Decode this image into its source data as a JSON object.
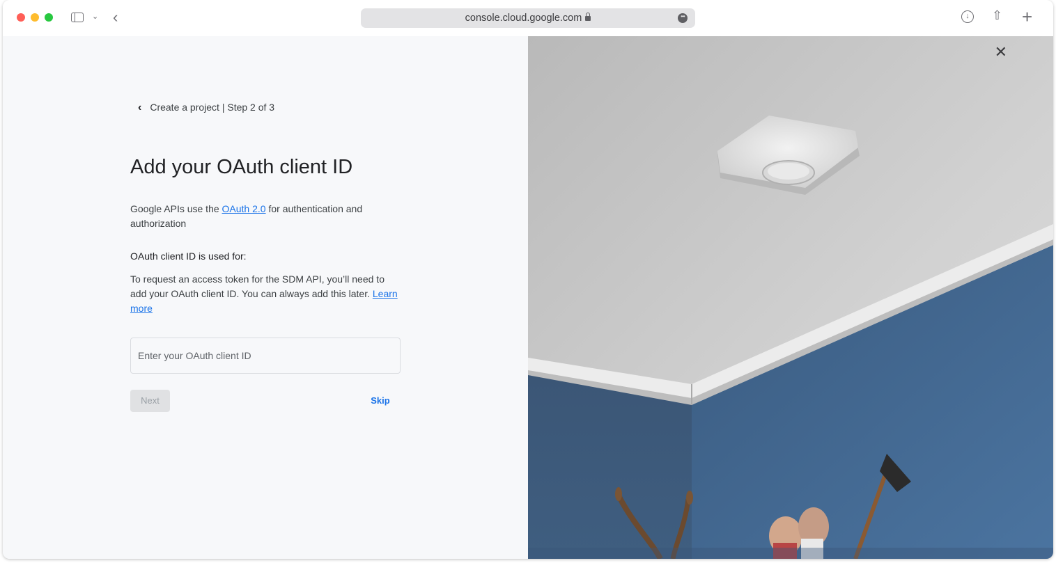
{
  "browser": {
    "url": "console.cloud.google.com",
    "icons": [
      "sidebar-icon",
      "chevron-down-icon",
      "back-icon",
      "lock-icon",
      "more-icon",
      "download-icon",
      "share-icon",
      "plus-icon"
    ]
  },
  "step": {
    "back_icon": "chevron-left-icon",
    "label": "Create a project | Step 2 of 3"
  },
  "title": "Add your OAuth client ID",
  "intro": {
    "before_link": "Google APIs use the ",
    "link": "OAuth 2.0",
    "after_link": " for authentication and authorization"
  },
  "usage_heading": "OAuth client ID is used for:",
  "usage_text": {
    "body": "To request an access token for the SDM API, you’ll need to add your OAuth client ID. You can always add this later. ",
    "link": "Learn more"
  },
  "input": {
    "placeholder": "Enter your OAuth client ID",
    "value": ""
  },
  "buttons": {
    "next": "Next",
    "skip": "Skip"
  },
  "photo": {
    "close_icon": "close-icon"
  },
  "colors": {
    "accent": "#1a73e8",
    "wall": "#43678f",
    "ceiling": "#c9c9c9"
  }
}
